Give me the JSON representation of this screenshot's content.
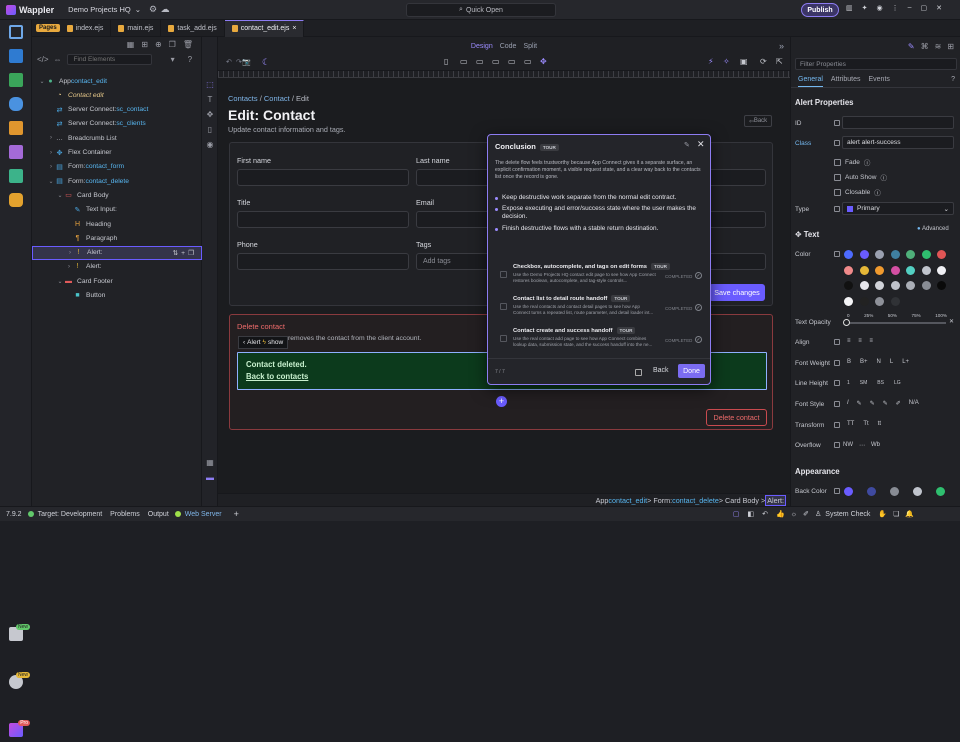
{
  "app": {
    "name": "Wappler",
    "project": "Demo Projects HQ",
    "quick_open": "Quick Open",
    "publish": "Publish"
  },
  "tabs": {
    "pages": "Pages",
    "items": [
      "index.ejs",
      "main.ejs",
      "task_add.ejs",
      "contact_edit.ejs"
    ]
  },
  "tree": {
    "search_placeholder": "Find Elements",
    "rows": [
      {
        "pre": "App ",
        "hl": "contact_edit"
      },
      {
        "pre": "",
        "it": "Contact edit"
      },
      {
        "pre": "Server Connect: ",
        "hl": "sc_contact"
      },
      {
        "pre": "Server Connect: ",
        "hl": "sc_clients"
      },
      {
        "pre": "Breadcrumb List"
      },
      {
        "pre": "Flex Container"
      },
      {
        "pre": "Form: ",
        "hl": "contact_form"
      },
      {
        "pre": "Form: ",
        "hl": "contact_delete"
      },
      {
        "pre": "Card Body"
      },
      {
        "pre": "Text Input:"
      },
      {
        "pre": "Heading"
      },
      {
        "pre": "Paragraph"
      },
      {
        "pre": "Alert:"
      },
      {
        "pre": "Alert:"
      },
      {
        "pre": "Card Footer"
      },
      {
        "pre": "Button"
      }
    ]
  },
  "viewbar": {
    "design": "Design",
    "code": "Code",
    "split": "Split"
  },
  "page": {
    "crumb1": "Contacts",
    "crumb2": "Contact",
    "crumb3": "Edit",
    "title": "Edit: Contact",
    "subtitle": "Update contact information and tags.",
    "back": "Back",
    "fields": {
      "first_name": "First name",
      "last_name": "Last name",
      "title": "Title",
      "email": "Email",
      "phone": "Phone",
      "tags": "Tags",
      "tags_placeholder": "Add tags"
    },
    "save": "Save changes",
    "delete_title": "Delete contact",
    "delete_desc": "removes the contact from the client account.",
    "alert_tag": "Alert",
    "alert_tag_show": "show",
    "alert_line1": "Contact deleted.",
    "alert_line2": "Back to contacts",
    "delete_btn": "Delete contact"
  },
  "tour": {
    "title": "Conclusion",
    "chip": "TOUR",
    "text": "The delete flow feels trustworthy because App Connect gives it a separate surface, an explicit confirmation moment, a visible request state, and a clear way back to the contacts list once the record is gone.",
    "bullets": [
      "Keep destructive work separate from the normal edit contract.",
      "Expose executing and error/success state where the user makes the decision.",
      "Finish destructive flows with a stable return destination."
    ],
    "items": [
      {
        "title": "Checkbox, autocomplete, and tags on edit forms",
        "chip": "TOUR",
        "desc": "Use the Demo Projects HQ contact edit page to see how App Connect restores boolean, autocomplete, and tag-style controls...",
        "status": "COMPLETED"
      },
      {
        "title": "Contact list to detail route handoff",
        "chip": "TOUR",
        "desc": "Use the real contacts and contact detail pages to see how App Connect turns a repeated list, route parameter, and detail loader int...",
        "status": "COMPLETED"
      },
      {
        "title": "Contact create and success handoff",
        "chip": "TOUR",
        "desc": "Use the real contact add page to see how App Connect combines lookup data, submission state, and the success handoff into the ne...",
        "status": "COMPLETED"
      }
    ],
    "page": "7 / 7",
    "back": "Back",
    "done": "Done"
  },
  "statuspath": {
    "app": "App ",
    "app_hl": "contact_edit",
    "form": " > Form: ",
    "form_hl": "contact_delete",
    "rest": " > Card Body > ",
    "cur": "Alert:"
  },
  "props": {
    "search_placeholder": "Filter Properties",
    "tab_general": "General",
    "tab_attributes": "Attributes",
    "tab_events": "Events",
    "section": "Alert Properties",
    "id_label": "ID",
    "class_label": "Class",
    "class_value": "alert alert-success",
    "fade": "Fade",
    "autoshow": "Auto Show",
    "closable": "Closable",
    "type_label": "Type",
    "type_value": "Primary",
    "text_section": "Text",
    "advanced": "Advanced",
    "color": "Color",
    "text_opacity": "Text Opacity",
    "opacity_ticks": [
      "0",
      "25%",
      "50%",
      "75%",
      "100%"
    ],
    "align": "Align",
    "font_weight": "Font Weight",
    "fw_opts": [
      "B",
      "B+",
      "N",
      "L",
      "L+"
    ],
    "line_height": "Line Height",
    "lh_opts": [
      "1",
      "SM",
      "BS",
      "LG"
    ],
    "font_style": "Font Style",
    "fs_opt": "N/A",
    "transform": "Transform",
    "tr_opts": [
      "TT",
      "Tt",
      "tt"
    ],
    "overflow": "Overflow",
    "ov_opts": [
      "NW",
      "Wb"
    ],
    "appearance": "Appearance",
    "back_color": "Back Color"
  },
  "bottom": {
    "version": "7.9.2",
    "target": "Target:  Development",
    "problems": "Problems",
    "output": "Output",
    "web_server": "Web Server",
    "system_check": "System Check"
  },
  "colors": {
    "accent": "#6a5cff",
    "danger": "#ef6b6b",
    "link": "#58b6f0",
    "success_bg": "#0c3a1c"
  }
}
